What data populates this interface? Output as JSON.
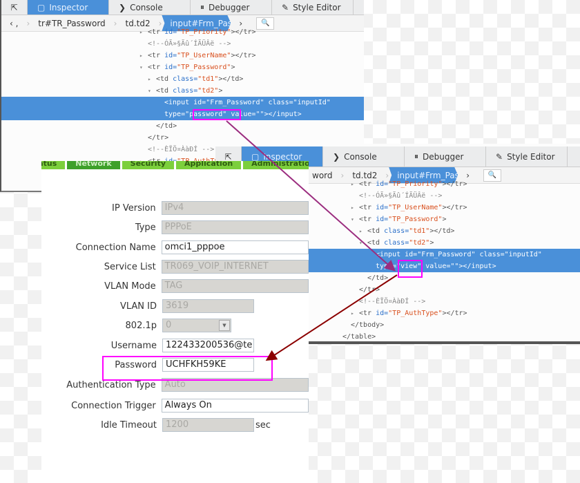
{
  "devtools_top": {
    "tabs": [
      {
        "label": "Inspector",
        "icon": "inspector-icon"
      },
      {
        "label": "Console",
        "icon": "console-icon"
      },
      {
        "label": "Debugger",
        "icon": "debugger-icon"
      },
      {
        "label": "Style Editor",
        "icon": "style-editor-icon"
      }
    ],
    "breadcrumbs": [
      "tr#TR_Password",
      "td.td2",
      "input#Frm_Password.inputId"
    ],
    "lines": [
      {
        "depth": 0,
        "tw": "▸",
        "tokens": [
          [
            "p",
            "<tr "
          ],
          [
            "a",
            "id="
          ],
          [
            "v",
            "\"TP_Priority\""
          ],
          [
            "p",
            "></tr>"
          ]
        ]
      },
      {
        "depth": 0,
        "tokens": [
          [
            "c",
            "<!--ÓÃ»§Ãû´ÍÃÜÂë -->"
          ]
        ]
      },
      {
        "depth": 0,
        "tw": "▸",
        "tokens": [
          [
            "p",
            "<tr "
          ],
          [
            "a",
            "id="
          ],
          [
            "v",
            "\"TP_UserName\""
          ],
          [
            "p",
            "></tr>"
          ]
        ]
      },
      {
        "depth": 0,
        "tw": "▾",
        "tokens": [
          [
            "p",
            "<tr "
          ],
          [
            "a",
            "id="
          ],
          [
            "v",
            "\"TP_Password\""
          ],
          [
            "p",
            ">"
          ]
        ]
      },
      {
        "depth": 1,
        "tw": "▸",
        "tokens": [
          [
            "p",
            "<td "
          ],
          [
            "a",
            "class="
          ],
          [
            "v",
            "\"td1\""
          ],
          [
            "p",
            "></td>"
          ]
        ]
      },
      {
        "depth": 1,
        "tw": "▾",
        "tokens": [
          [
            "p",
            "<td "
          ],
          [
            "a",
            "class="
          ],
          [
            "v",
            "\"td2\""
          ],
          [
            "p",
            ">"
          ]
        ]
      },
      {
        "depth": 2,
        "hl": true,
        "tokens": [
          [
            "p",
            "<input id=\"Frm_Password\" class=\"inputId\""
          ]
        ]
      },
      {
        "depth": 2,
        "hl": true,
        "tokens": [
          [
            "p",
            "type=\"password\" value=\"\"></input>"
          ]
        ]
      },
      {
        "depth": 1,
        "tokens": [
          [
            "p",
            "</td>"
          ]
        ]
      },
      {
        "depth": 0,
        "tokens": [
          [
            "p",
            "</tr>"
          ]
        ]
      },
      {
        "depth": 0,
        "tokens": [
          [
            "c",
            "<!--ÈÏÖ¤ÀàÐÍ -->"
          ]
        ]
      },
      {
        "depth": 0,
        "tw": "▸",
        "tokens": [
          [
            "p",
            "<tr "
          ],
          [
            "a",
            "id="
          ],
          [
            "v",
            "\"TP_AuthType\""
          ],
          [
            "p",
            "></tr>"
          ]
        ]
      }
    ]
  },
  "devtools_bottom": {
    "tabs": [
      {
        "label": "Inspector",
        "icon": "inspector-icon"
      },
      {
        "label": "Console",
        "icon": "console-icon"
      },
      {
        "label": "Debugger",
        "icon": "debugger-icon"
      },
      {
        "label": "Style Editor",
        "icon": "style-editor-icon"
      }
    ],
    "breadcrumbs": [
      "word",
      "td.td2",
      "input#Frm_Password.inputId"
    ],
    "lines": [
      {
        "depth": 0,
        "tw": "▸",
        "tokens": [
          [
            "p",
            "<tr "
          ],
          [
            "a",
            "id="
          ],
          [
            "v",
            "\"TP_Priority\""
          ],
          [
            "p",
            "></tr>"
          ]
        ]
      },
      {
        "depth": 0,
        "tokens": [
          [
            "c",
            "<!--ÓÃ»§Ãû´ÍÃÜÂë -->"
          ]
        ]
      },
      {
        "depth": 0,
        "tw": "▸",
        "tokens": [
          [
            "p",
            "<tr "
          ],
          [
            "a",
            "id="
          ],
          [
            "v",
            "\"TP_UserName\""
          ],
          [
            "p",
            "></tr>"
          ]
        ]
      },
      {
        "depth": 0,
        "tw": "▾",
        "tokens": [
          [
            "p",
            "<tr "
          ],
          [
            "a",
            "id="
          ],
          [
            "v",
            "\"TP_Password\""
          ],
          [
            "p",
            ">"
          ]
        ]
      },
      {
        "depth": 1,
        "tw": "▸",
        "tokens": [
          [
            "p",
            "<td "
          ],
          [
            "a",
            "class="
          ],
          [
            "v",
            "\"td1\""
          ],
          [
            "p",
            "></td>"
          ]
        ]
      },
      {
        "depth": 1,
        "tw": "▾",
        "tokens": [
          [
            "p",
            "<td "
          ],
          [
            "a",
            "class="
          ],
          [
            "v",
            "\"td2\""
          ],
          [
            "p",
            ">"
          ]
        ]
      },
      {
        "depth": 2,
        "hl": true,
        "tokens": [
          [
            "p",
            "<input id=\"Frm_Password\" class=\"inputId\""
          ]
        ]
      },
      {
        "depth": 2,
        "hl": true,
        "tokens": [
          [
            "p",
            "type=\"view\" value=\"\"></input>"
          ]
        ]
      },
      {
        "depth": 1,
        "tokens": [
          [
            "p",
            "</td>"
          ]
        ]
      },
      {
        "depth": 0,
        "tokens": [
          [
            "p",
            "</tr>"
          ]
        ]
      },
      {
        "depth": 0,
        "tokens": [
          [
            "c",
            "<!--ÈÏÖ¤ÀàÐÍ -->"
          ]
        ]
      },
      {
        "depth": 0,
        "tw": "▸",
        "tokens": [
          [
            "p",
            "<tr "
          ],
          [
            "a",
            "id="
          ],
          [
            "v",
            "\"TP_AuthType\""
          ],
          [
            "p",
            "></tr>"
          ]
        ]
      },
      {
        "depth": -1,
        "tokens": [
          [
            "p",
            "</tbody>"
          ]
        ]
      },
      {
        "depth": -2,
        "tokens": [
          [
            "p",
            "</table>"
          ]
        ]
      }
    ]
  },
  "router_form": {
    "tabs": [
      {
        "label": "Status",
        "active": false
      },
      {
        "label": "Network",
        "active": true
      },
      {
        "label": "Security",
        "active": false
      },
      {
        "label": "Application",
        "active": false
      },
      {
        "label": "Administration",
        "active": false
      }
    ],
    "fields": [
      {
        "label": "IP Version",
        "value": "IPv4",
        "enabled": false,
        "width": "full"
      },
      {
        "label": "Type",
        "value": "PPPoE",
        "enabled": false,
        "width": "full"
      },
      {
        "label": "Connection Name",
        "value": "omci1_pppoe",
        "enabled": true,
        "width": "full"
      },
      {
        "label": "Service List",
        "value": "TR069_VOIP_INTERNET",
        "enabled": false,
        "width": "full"
      },
      {
        "label": "VLAN Mode",
        "value": "TAG",
        "enabled": false,
        "width": "full"
      },
      {
        "label": "VLAN ID",
        "value": "3619",
        "enabled": false,
        "width": "short"
      },
      {
        "label": "802.1p",
        "value": "0",
        "enabled": false,
        "width": "sel"
      },
      {
        "label": "Username",
        "value": "122433200536@te",
        "enabled": true,
        "width": "short"
      },
      {
        "label": "Password",
        "value": "UCHFKH59KE",
        "enabled": true,
        "width": "short",
        "highlighted": true
      },
      {
        "label": "Authentication Type",
        "value": "Auto",
        "enabled": false,
        "width": "full"
      },
      {
        "label": "Connection Trigger",
        "value": "Always On",
        "enabled": true,
        "width": "full"
      },
      {
        "label": "Idle Timeout",
        "value": "1200",
        "enabled": false,
        "width": "short",
        "unit": "sec"
      }
    ]
  },
  "colors": {
    "highlight_box": "#ff00ff",
    "arrow_1": "#9b2d7f",
    "arrow_2": "#8b0000",
    "devtools_accent": "#4a90d9",
    "tab_green": "#7ccf3c"
  }
}
